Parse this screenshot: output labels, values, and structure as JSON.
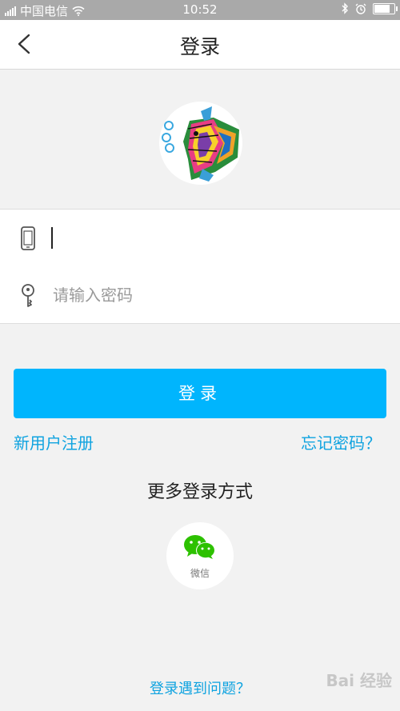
{
  "status_bar": {
    "carrier": "中国电信",
    "time": "10:52",
    "battery_level": 0.85
  },
  "nav": {
    "title": "登录",
    "back_icon": "chevron-left-icon"
  },
  "form": {
    "phone_value": "",
    "phone_icon": "phone-icon",
    "password_placeholder": "请输入密码",
    "password_icon": "key-icon"
  },
  "actions": {
    "login_label": "登录",
    "register_label": "新用户注册",
    "forgot_label": "忘记密码？"
  },
  "more_login": {
    "title": "更多登录方式",
    "wechat_label": "微信",
    "wechat_icon": "wechat-icon"
  },
  "help_label": "登录遇到问题？",
  "watermark": "Bai  经验",
  "colors": {
    "accent": "#00b5fd",
    "link": "#0fa3e0",
    "wechat_green": "#2dc100"
  }
}
